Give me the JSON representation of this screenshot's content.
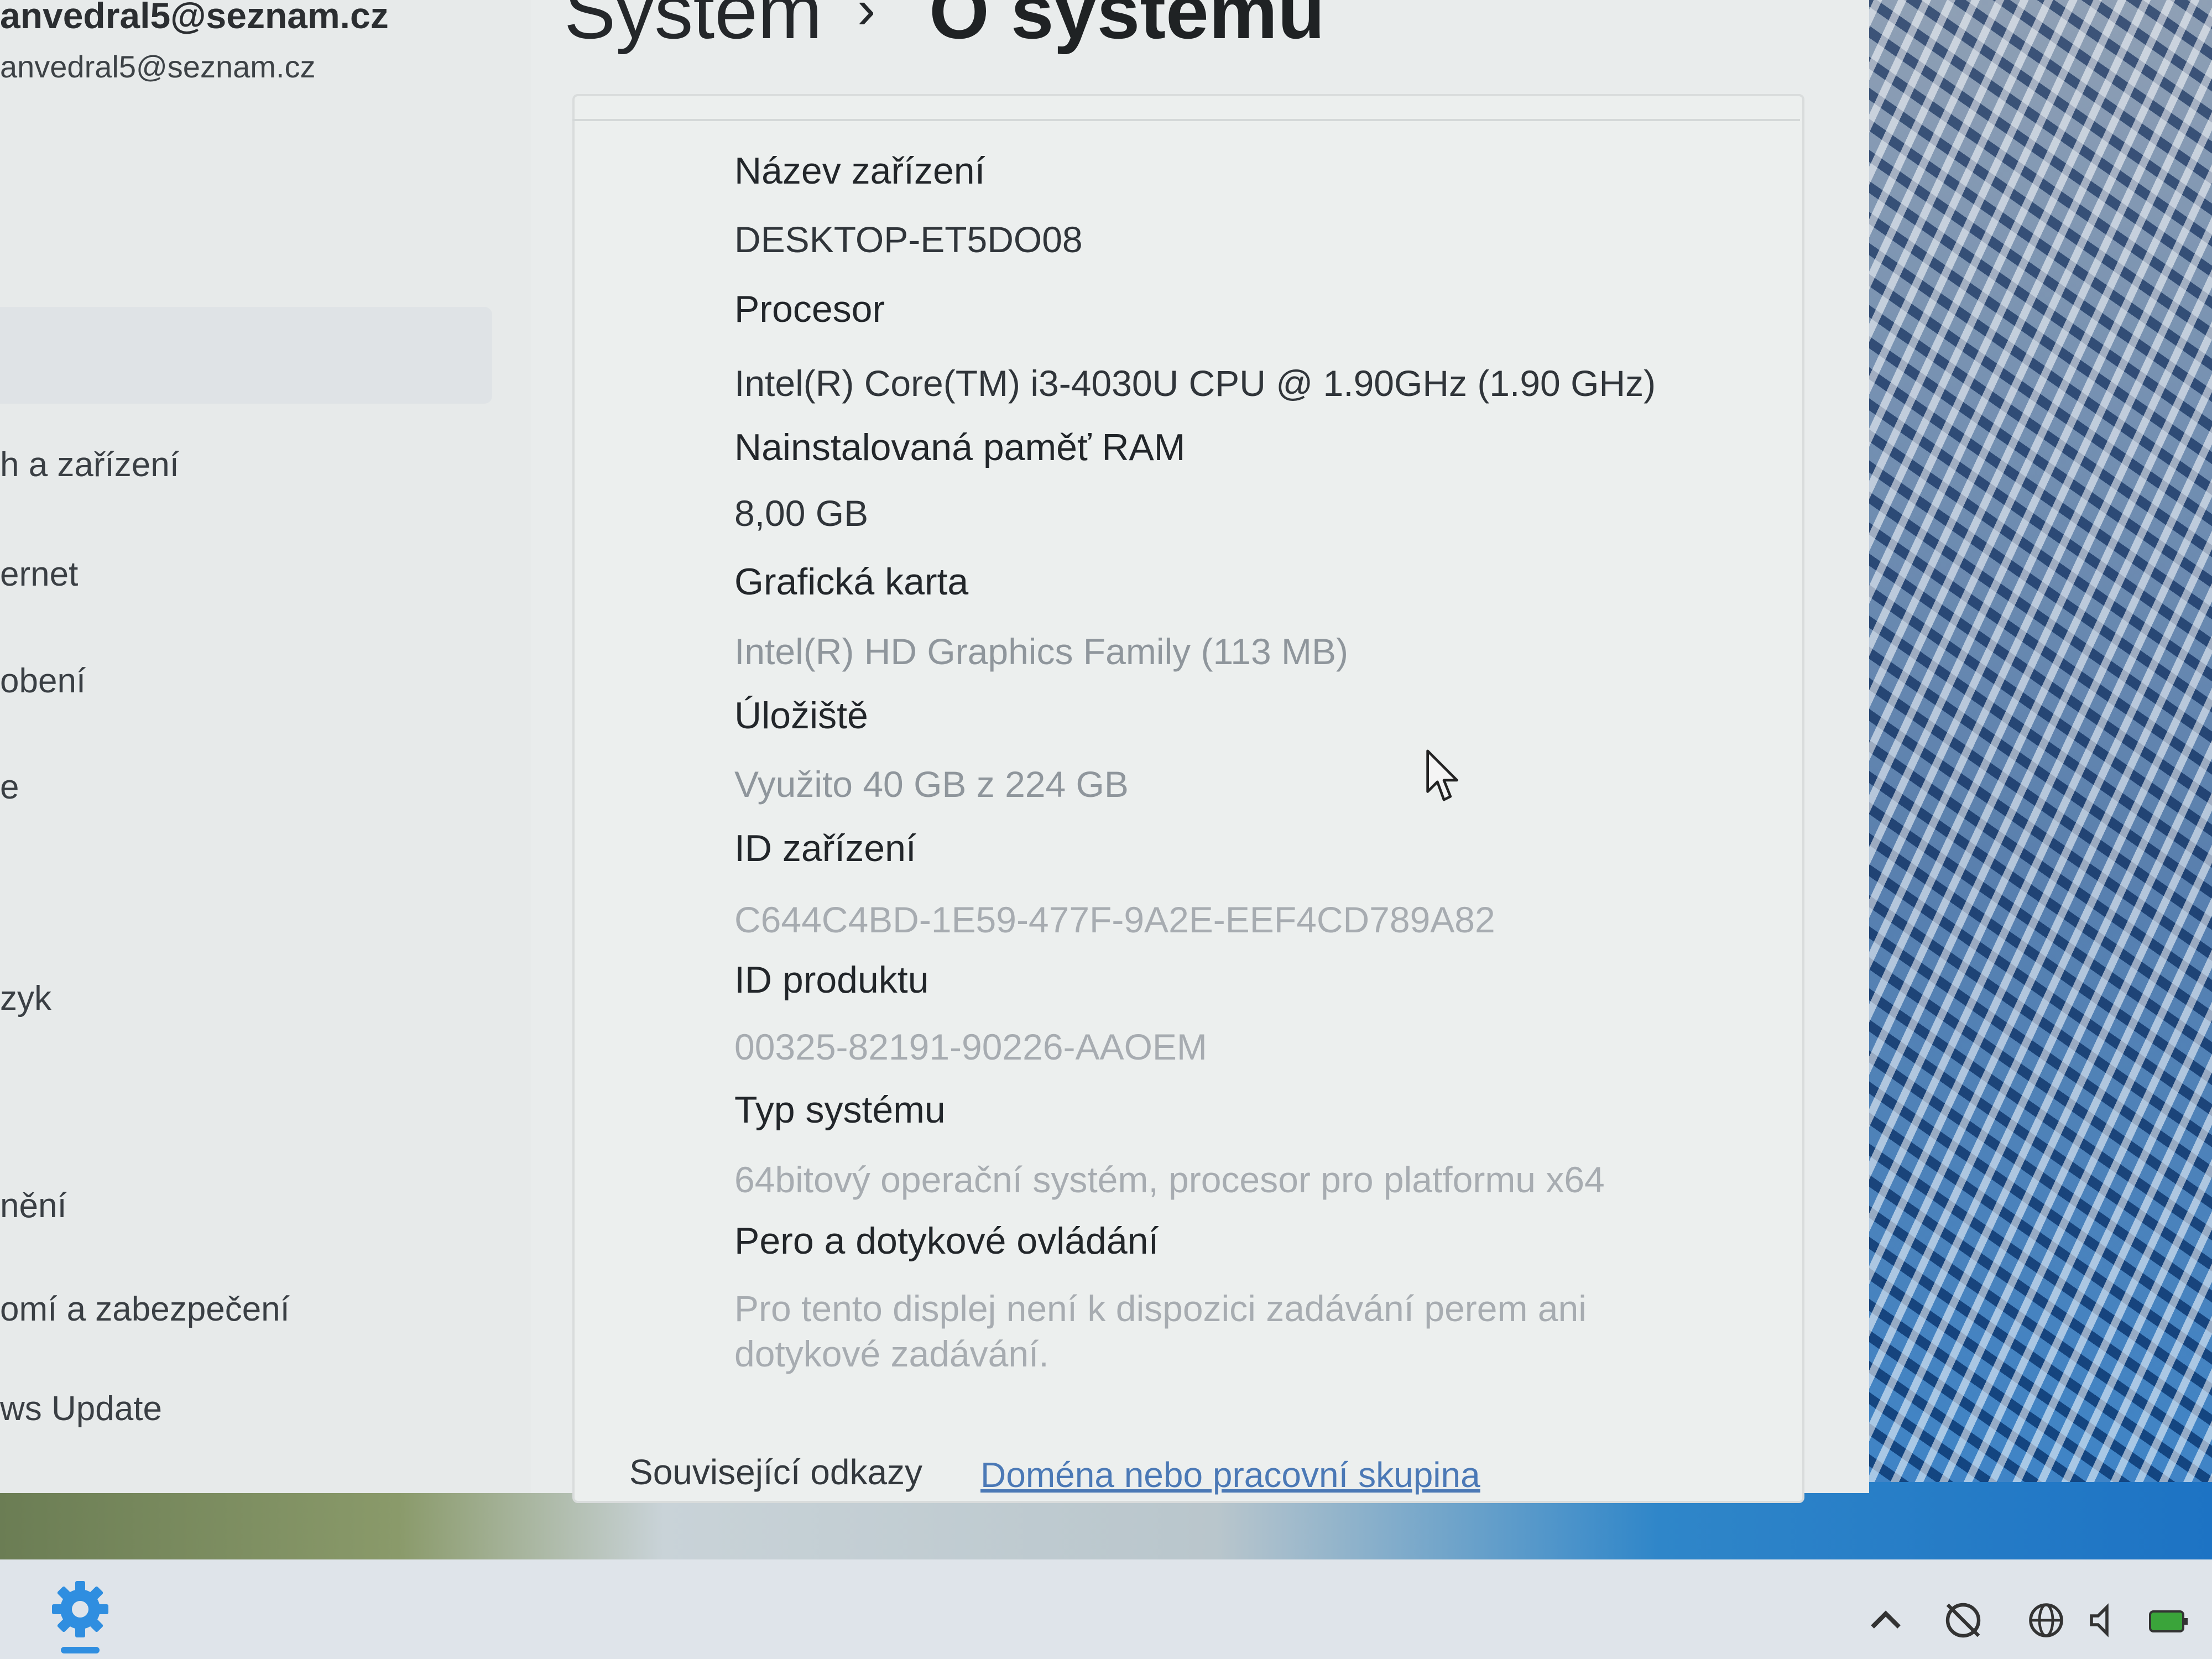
{
  "account": {
    "name": "anvedral5@seznam.cz",
    "email": "anvedral5@seznam.cz"
  },
  "sidebar": {
    "items": [
      {
        "label": "h a zařízení"
      },
      {
        "label": "ernet"
      },
      {
        "label": "obení"
      },
      {
        "label": "e"
      },
      {
        "label": "zyk"
      },
      {
        "label": "nění"
      },
      {
        "label": "omí a zabezpečení"
      },
      {
        "label": "ws Update"
      }
    ]
  },
  "breadcrumb": {
    "root": "Systém",
    "separator": "›",
    "current": "O systému"
  },
  "specs": {
    "device_name_label": "Název zařízení",
    "device_name_value": "DESKTOP-ET5DO08",
    "processor_label": "Procesor",
    "processor_value": "Intel(R) Core(TM) i3-4030U CPU @ 1.90GHz (1.90 GHz)",
    "ram_label": "Nainstalovaná paměť RAM",
    "ram_value": "8,00 GB",
    "graphics_label": "Grafická karta",
    "graphics_value": "Intel(R) HD Graphics Family (113 MB)",
    "storage_label": "Úložiště",
    "storage_value": "Využito 40 GB z 224 GB",
    "device_id_label": "ID zařízení",
    "device_id_value": "C644C4BD-1E59-477F-9A2E-EEF4CD789A82",
    "product_id_label": "ID produktu",
    "product_id_value": "00325-82191-90226-AAOEM",
    "system_type_label": "Typ systému",
    "system_type_value": "64bitový operační systém, procesor pro platformu x64",
    "pen_touch_label": "Pero a dotykové ovládání",
    "pen_touch_value": "Pro tento displej není k dispozici zadávání perem ani dotykové zadávání."
  },
  "related": {
    "label": "Související odkazy",
    "link": "Doména nebo pracovní skupina"
  },
  "icons": {
    "cursor": "mouse-pointer-icon",
    "taskbar_settings": "gear-icon",
    "tray": [
      "chevron-up-icon",
      "network-off-icon",
      "globe-icon",
      "speaker-icon",
      "battery-icon"
    ]
  },
  "colors": {
    "link": "#4b79b6",
    "accent": "#2f8ee0"
  }
}
